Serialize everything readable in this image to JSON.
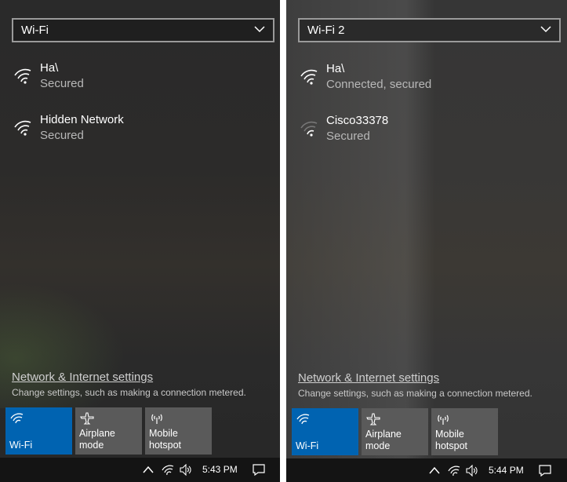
{
  "left": {
    "dropdown": {
      "value": "Wi-Fi"
    },
    "networks": [
      {
        "name": "Ha\\",
        "status": "Secured",
        "icon": "wifi-strong-icon"
      },
      {
        "name": "Hidden Network",
        "status": "Secured",
        "icon": "wifi-strong-icon"
      }
    ],
    "settings": {
      "link": "Network & Internet settings",
      "desc": "Change settings, such as making a connection metered."
    },
    "tiles": [
      {
        "label": "Wi-Fi",
        "icon": "wifi-icon",
        "active": true
      },
      {
        "label": "Airplane mode",
        "icon": "airplane-icon",
        "active": false
      },
      {
        "label": "Mobile\nhotspot",
        "icon": "hotspot-icon",
        "active": false
      }
    ],
    "taskbar": {
      "time": "5:43 PM"
    }
  },
  "right": {
    "dropdown": {
      "value": "Wi-Fi 2"
    },
    "networks": [
      {
        "name": "Ha\\",
        "status": "Connected, secured",
        "icon": "wifi-strong-icon"
      },
      {
        "name": "Cisco33378",
        "status": "Secured",
        "icon": "wifi-weak-icon"
      }
    ],
    "settings": {
      "link": "Network & Internet settings",
      "desc": "Change settings, such as making a connection metered."
    },
    "tiles": [
      {
        "label": "Wi-Fi",
        "icon": "wifi-icon",
        "active": true
      },
      {
        "label": "Airplane mode",
        "icon": "airplane-icon",
        "active": false
      },
      {
        "label": "Mobile\nhotspot",
        "icon": "hotspot-icon",
        "active": false
      }
    ],
    "taskbar": {
      "time": "5:44 PM"
    }
  },
  "colors": {
    "accent": "#0063b1",
    "tile": "#5a5a5a",
    "taskbar": "#141414"
  }
}
